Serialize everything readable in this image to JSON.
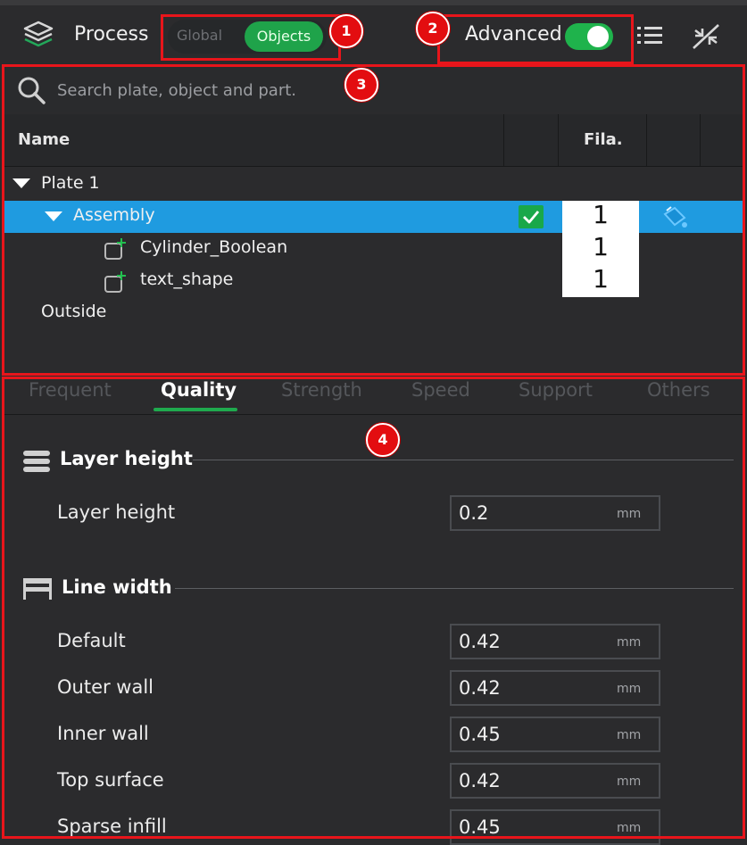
{
  "header": {
    "process_label": "Process",
    "scope_global": "Global",
    "scope_objects": "Objects",
    "advanced_label": "Advanced",
    "advanced_on": true
  },
  "badges": [
    "1",
    "2",
    "3",
    "4"
  ],
  "search": {
    "placeholder": "Search plate, object and part."
  },
  "table": {
    "col_name": "Name",
    "col_fila": "Fila.",
    "plate": "Plate 1",
    "assembly": "Assembly",
    "parts": [
      "Cylinder_Boolean",
      "text_shape"
    ],
    "outside": "Outside",
    "fila_values": [
      "1",
      "1",
      "1"
    ]
  },
  "tabs": [
    "Frequent",
    "Quality",
    "Strength",
    "Speed",
    "Support",
    "Others"
  ],
  "active_tab": "Quality",
  "sections": {
    "layer_height_title": "Layer height",
    "line_width_title": "Line width"
  },
  "settings": [
    {
      "label": "Layer height",
      "value": "0.2",
      "unit": "mm"
    },
    {
      "label": "Default",
      "value": "0.42",
      "unit": "mm"
    },
    {
      "label": "Outer wall",
      "value": "0.42",
      "unit": "mm"
    },
    {
      "label": "Inner wall",
      "value": "0.45",
      "unit": "mm"
    },
    {
      "label": "Top surface",
      "value": "0.42",
      "unit": "mm"
    },
    {
      "label": "Sparse infill",
      "value": "0.45",
      "unit": "mm"
    }
  ],
  "colors": {
    "accent_green": "#1fa34a",
    "selection_blue": "#1f9be0",
    "annotation_red": "#e8151b"
  }
}
